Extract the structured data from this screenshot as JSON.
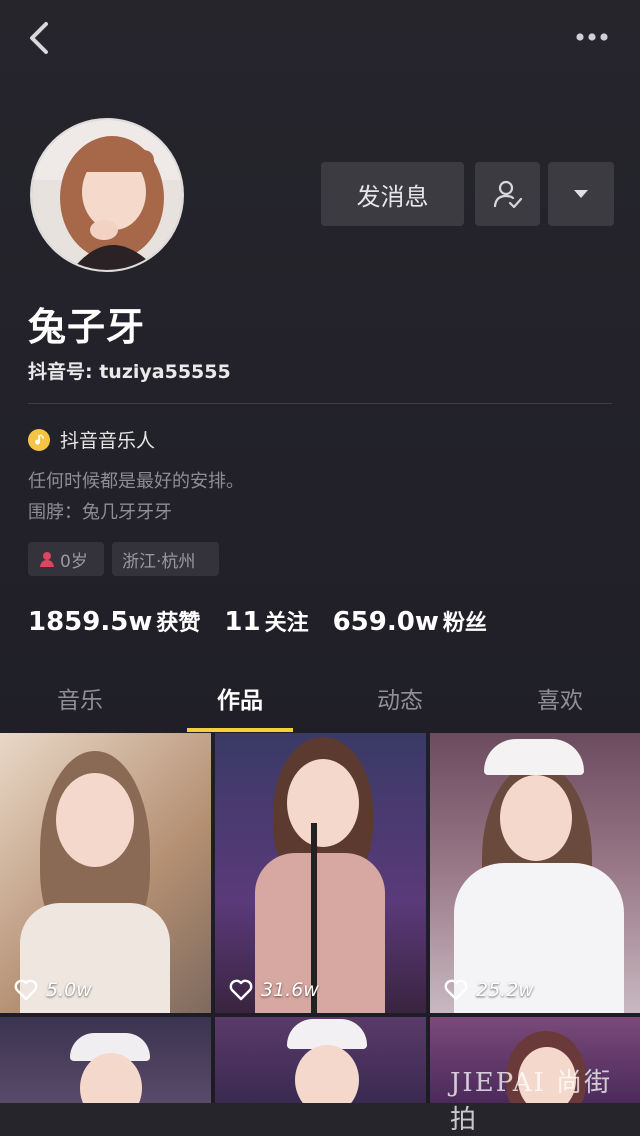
{
  "header": {
    "back_icon": "chevron-left-icon",
    "more_icon": "more-dots-icon"
  },
  "profile": {
    "name": "兔子牙",
    "douyin_id": "抖音号: tuziya55555",
    "badge": "抖音音乐人",
    "bio": "任何时候都是最好的安排。",
    "scarf": "围脖：兔几牙牙牙",
    "age": "0岁",
    "location": "浙江·杭州"
  },
  "actions": {
    "message_label": "发消息",
    "follow_icon": "user-check-icon",
    "dropdown_icon": "caret-down-icon"
  },
  "stats": [
    {
      "value": "1859.5w",
      "label": "获赞"
    },
    {
      "value": "11",
      "label": "关注"
    },
    {
      "value": "659.0w",
      "label": "粉丝"
    }
  ],
  "tabs": [
    {
      "label": "音乐",
      "active": false
    },
    {
      "label": "作品",
      "active": true
    },
    {
      "label": "动态",
      "active": false
    },
    {
      "label": "喜欢",
      "active": false
    }
  ],
  "videos": [
    {
      "likes": "5.0w"
    },
    {
      "likes": "31.6w"
    },
    {
      "likes": "25.2w"
    }
  ],
  "watermark": "JIEPAI 尚街拍",
  "colors": {
    "accent": "#f4cf3f",
    "background": "#222129",
    "button": "#3c3b42"
  }
}
